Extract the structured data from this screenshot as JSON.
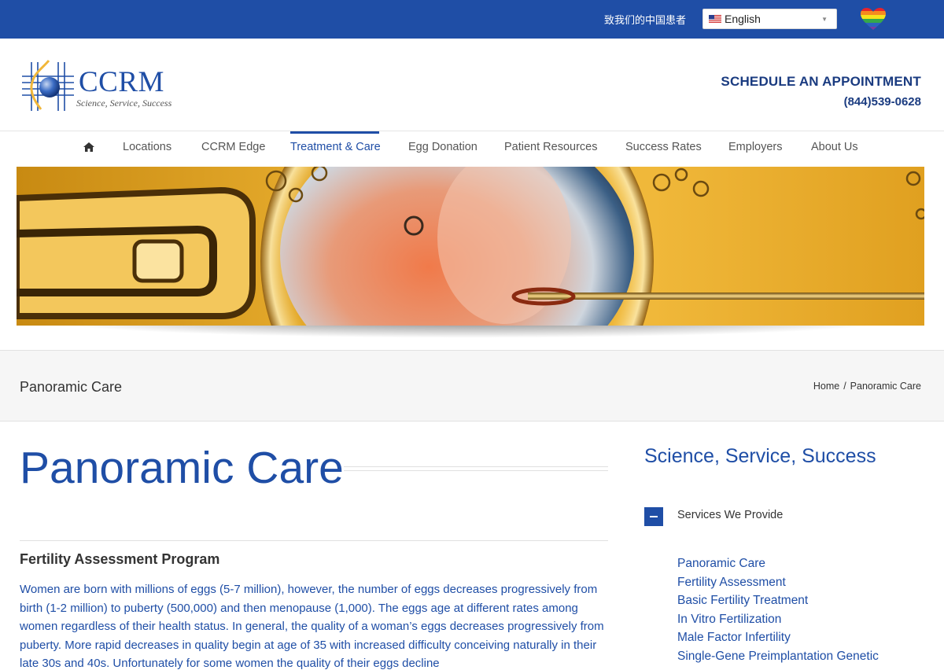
{
  "topbar": {
    "chinese_link": "致我们的中国患者",
    "language": {
      "selected": "English",
      "flag_icon": "us-flag-icon"
    },
    "heart_icon": "rainbow-heart-icon",
    "bg_color": "#1f4ea6"
  },
  "header": {
    "logo_text": "CCRM",
    "logo_tagline": "Science, Service, Success",
    "schedule_label": "SCHEDULE AN APPOINTMENT",
    "phone": "(844)539-0628"
  },
  "nav": {
    "home_icon": "home-icon",
    "items": [
      {
        "label": "Locations"
      },
      {
        "label": "CCRM Edge"
      },
      {
        "label": "Treatment & Care",
        "active": true
      },
      {
        "label": "Egg Donation"
      },
      {
        "label": "Patient Resources"
      },
      {
        "label": "Success Rates"
      },
      {
        "label": "Employers"
      },
      {
        "label": "About Us"
      }
    ]
  },
  "titlebar": {
    "page_name": "Panoramic Care",
    "breadcrumb": [
      "Home",
      "Panoramic Care"
    ]
  },
  "main": {
    "title": "Panoramic Care",
    "section_heading": "Fertility Assessment Program",
    "body": "Women are born with millions of eggs (5-7 million), however, the number of eggs decreases progressively from birth (1-2 million) to puberty (500,000) and then menopause (1,000). The eggs age at different rates among women regardless of their health status. In general, the quality of a woman’s eggs decreases progressively from puberty. More rapid decreases in quality begin at age of 35 with increased difficulty conceiving naturally in their late 30s and 40s. Unfortunately for some women the quality of their eggs decline"
  },
  "sidebar": {
    "title": "Science, Service, Success",
    "toggle_label": "Services We Provide",
    "services": [
      "Panoramic Care",
      "Fertility Assessment",
      "Basic Fertility Treatment",
      "In Vitro Fertilization",
      "Male Factor Infertility",
      "Single-Gene Preimplantation Genetic"
    ]
  },
  "colors": {
    "brand_blue": "#1f4ea6",
    "heading_navy": "#1a3b80",
    "titlebar_bg": "#f6f6f6"
  }
}
